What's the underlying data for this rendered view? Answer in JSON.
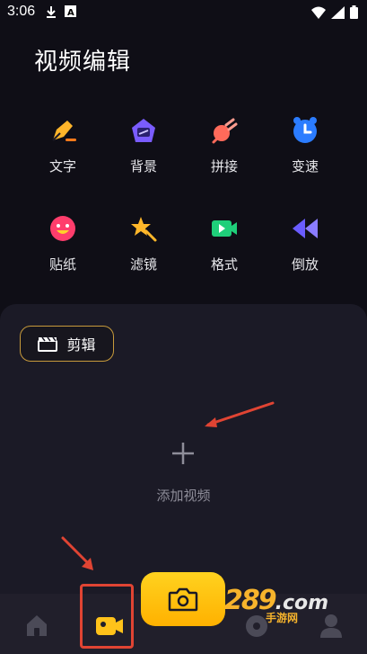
{
  "status_bar": {
    "time": "3:06"
  },
  "title": "视频编辑",
  "tools": [
    {
      "label": "文字",
      "icon": "pen-nib-icon"
    },
    {
      "label": "背景",
      "icon": "background-icon"
    },
    {
      "label": "拼接",
      "icon": "splice-icon"
    },
    {
      "label": "变速",
      "icon": "speed-clock-icon"
    },
    {
      "label": "贴纸",
      "icon": "sticker-face-icon"
    },
    {
      "label": "滤镜",
      "icon": "filter-star-icon"
    },
    {
      "label": "格式",
      "icon": "format-video-icon"
    },
    {
      "label": "倒放",
      "icon": "rewind-icon"
    }
  ],
  "edit_chip": {
    "label": "剪辑",
    "icon": "clapperboard-icon"
  },
  "add_video": {
    "label": "添加视频"
  },
  "watermark": {
    "number": "289",
    "domain": ".com",
    "sub": "手游网"
  },
  "colors": {
    "accent": "#ffc21a",
    "background": "#0f0e16",
    "panel": "#1b1a26",
    "annotation": "#e04433"
  }
}
